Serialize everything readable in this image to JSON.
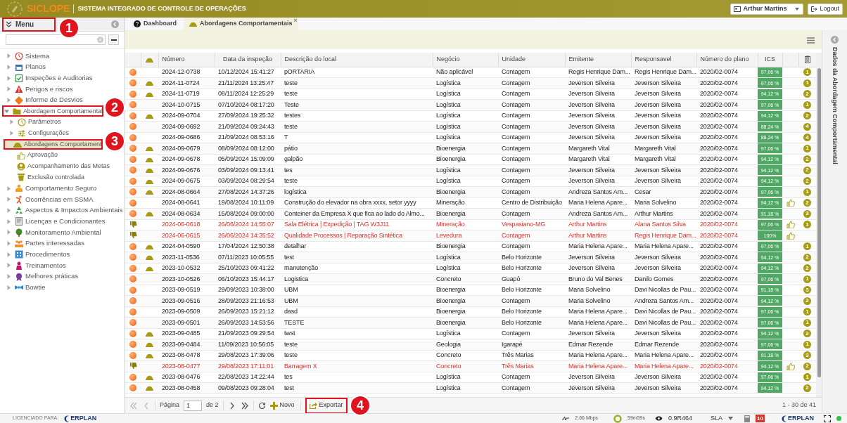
{
  "header": {
    "logo": "SICLOPE",
    "subtitle": "SISTEMA INTEGRADO DE CONTROLE DE OPERAÇÕES",
    "user": "Arthur Martins",
    "logout": "Logout"
  },
  "menu": {
    "title": "Menu",
    "items": [
      {
        "label": "Sistema",
        "kind": "branch",
        "expanded": false,
        "selected": false
      },
      {
        "label": "Planos",
        "kind": "branch",
        "expanded": false,
        "selected": false
      },
      {
        "label": "Inspeções e Auditorias",
        "kind": "branch",
        "expanded": false,
        "selected": false
      },
      {
        "label": "Perigos e riscos",
        "kind": "branch",
        "expanded": false,
        "selected": false
      },
      {
        "label": "Informe de Desvios",
        "kind": "branch",
        "expanded": false,
        "selected": false
      },
      {
        "label": "Abordagem Comportamental",
        "kind": "branch",
        "expanded": true,
        "selected": false,
        "children": [
          {
            "label": "Parâmetros",
            "kind": "branch",
            "expanded": false,
            "selected": false
          },
          {
            "label": "Configurações",
            "kind": "branch",
            "expanded": false,
            "selected": false
          },
          {
            "label": "Abordagens Comportament",
            "kind": "leaf",
            "selected": true
          },
          {
            "label": "Aprovação",
            "kind": "leaf",
            "selected": false
          },
          {
            "label": "Acompanhamento das Metas",
            "kind": "leaf",
            "selected": false
          },
          {
            "label": "Exclusão controlada",
            "kind": "leaf",
            "selected": false
          }
        ]
      },
      {
        "label": "Comportamento Seguro",
        "kind": "branch",
        "expanded": false,
        "selected": false
      },
      {
        "label": "Ocorrências em SSMA",
        "kind": "branch",
        "expanded": false,
        "selected": false
      },
      {
        "label": "Aspectos & Impactos Ambientais",
        "kind": "branch",
        "expanded": false,
        "selected": false
      },
      {
        "label": "Licenças e Condicionantes",
        "kind": "branch",
        "expanded": false,
        "selected": false
      },
      {
        "label": "Monitoramento Ambiental",
        "kind": "branch",
        "expanded": false,
        "selected": false
      },
      {
        "label": "Partes interessadas",
        "kind": "branch",
        "expanded": false,
        "selected": false
      },
      {
        "label": "Procedimentos",
        "kind": "branch",
        "expanded": false,
        "selected": false
      },
      {
        "label": "Treinamentos",
        "kind": "branch",
        "expanded": false,
        "selected": false
      },
      {
        "label": "Melhores práticas",
        "kind": "branch",
        "expanded": false,
        "selected": false
      },
      {
        "label": "Bowtie",
        "kind": "branch",
        "expanded": false,
        "selected": false
      }
    ]
  },
  "tabs": [
    {
      "label": "Dashboard",
      "selected": false
    },
    {
      "label": "Abordagens Comportamentais",
      "selected": true,
      "close": "×"
    }
  ],
  "side_panel": {
    "title": "Dados da Abordagem Comportamental"
  },
  "table": {
    "columns": [
      "Número",
      "Data da inspeção",
      "Descrição do local",
      "Negócio",
      "Unidade",
      "Emitente",
      "Responsavel",
      "Número do plano",
      "ICS"
    ],
    "rows": [
      {
        "kind": "dot",
        "helmet": false,
        "number": "2024-12-0738",
        "date": "10/12/2024 15:41:27",
        "location": "pORTARIA",
        "business": "Não aplicável",
        "unit": "Contagem",
        "issuer": "Regis Henrique Dam...",
        "responsible": "Regis Henrique Dam...",
        "plan": "2020/02-0074",
        "ics": "97,06 %",
        "approved": false,
        "count": "1",
        "flagged": false
      },
      {
        "kind": "dot",
        "helmet": true,
        "number": "2024-11-0724",
        "date": "21/11/2024 13:25:47",
        "location": "teste",
        "business": "Logística",
        "unit": "Contagem",
        "issuer": "Jeverson Silveira",
        "responsible": "Jeverson Silveira",
        "plan": "2020/02-0074",
        "ics": "97,06 %",
        "approved": false,
        "count": "1",
        "flagged": false
      },
      {
        "kind": "dot",
        "helmet": true,
        "number": "2024-11-0719",
        "date": "08/11/2024 12:25:29",
        "location": "teste",
        "business": "Logística",
        "unit": "Contagem",
        "issuer": "Jeverson Silveira",
        "responsible": "Jeverson Silveira",
        "plan": "2020/02-0074",
        "ics": "94,12 %",
        "approved": false,
        "count": "2",
        "flagged": false
      },
      {
        "kind": "dot",
        "helmet": false,
        "number": "2024-10-0715",
        "date": "07/10/2024 08:17:20",
        "location": "Teste",
        "business": "Logística",
        "unit": "Contagem",
        "issuer": "Jeverson Silveira",
        "responsible": "Jeverson Silveira",
        "plan": "2020/02-0074",
        "ics": "97,06 %",
        "approved": false,
        "count": "1",
        "flagged": false
      },
      {
        "kind": "dot",
        "helmet": true,
        "number": "2024-09-0704",
        "date": "27/09/2024 19:25:32",
        "location": "testes",
        "business": "Logística",
        "unit": "Contagem",
        "issuer": "Jeverson Silveira",
        "responsible": "Jeverson Silveira",
        "plan": "2020/02-0074",
        "ics": "94,12 %",
        "approved": false,
        "count": "2",
        "flagged": false
      },
      {
        "kind": "dot",
        "helmet": false,
        "number": "2024-09-0692",
        "date": "21/09/2024 09:24:43",
        "location": "teste",
        "business": "Logística",
        "unit": "Contagem",
        "issuer": "Jeverson Silveira",
        "responsible": "Jeverson Silveira",
        "plan": "2020/02-0074",
        "ics": "88,24 %",
        "approved": false,
        "count": "4",
        "flagged": false
      },
      {
        "kind": "dot",
        "helmet": false,
        "number": "2024-09-0686",
        "date": "21/09/2024 08:53:16",
        "location": "T",
        "business": "Logística",
        "unit": "Contagem",
        "issuer": "Jeverson Silveira",
        "responsible": "Jeverson Silveira",
        "plan": "2020/02-0074",
        "ics": "88,24 %",
        "approved": false,
        "count": "4",
        "flagged": false
      },
      {
        "kind": "dot",
        "helmet": true,
        "number": "2024-09-0679",
        "date": "08/09/2024 08:12:00",
        "location": "pátio",
        "business": "Bioenergia",
        "unit": "Contagem",
        "issuer": "Margareth Vital",
        "responsible": "Margareth Vital",
        "plan": "2020/02-0074",
        "ics": "97,06 %",
        "approved": false,
        "count": "1",
        "flagged": false
      },
      {
        "kind": "dot",
        "helmet": true,
        "number": "2024-09-0678",
        "date": "05/09/2024 15:09:09",
        "location": "galpão",
        "business": "Bioenergia",
        "unit": "Contagem",
        "issuer": "Margareth Vital",
        "responsible": "Margareth Vital",
        "plan": "2020/02-0074",
        "ics": "94,12 %",
        "approved": false,
        "count": "2",
        "flagged": false
      },
      {
        "kind": "dot",
        "helmet": true,
        "number": "2024-09-0676",
        "date": "03/09/2024 09:13:41",
        "location": "tes",
        "business": "Logística",
        "unit": "Contagem",
        "issuer": "Jeverson Silveira",
        "responsible": "Jeverson Silveira",
        "plan": "2020/02-0074",
        "ics": "94,12 %",
        "approved": false,
        "count": "2",
        "flagged": false
      },
      {
        "kind": "dot",
        "helmet": true,
        "number": "2024-09-0675",
        "date": "03/09/2024 08:29:54",
        "location": "teste",
        "business": "Logística",
        "unit": "Contagem",
        "issuer": "Jeverson Silveira",
        "responsible": "Jeverson Silveira",
        "plan": "2020/02-0074",
        "ics": "94,12 %",
        "approved": false,
        "count": "2",
        "flagged": false
      },
      {
        "kind": "dot",
        "helmet": true,
        "number": "2024-08-0664",
        "date": "27/08/2024 14:37:26",
        "location": "logística",
        "business": "Bioenergia",
        "unit": "Contagem",
        "issuer": "Andreza Santos Am...",
        "responsible": "Cesar",
        "plan": "2020/02-0074",
        "ics": "97,06 %",
        "approved": false,
        "count": "1",
        "flagged": false
      },
      {
        "kind": "dot",
        "helmet": false,
        "number": "2024-08-0641",
        "date": "19/08/2024 10:11:09",
        "location": "Construção do elevador na obra xxxx, setor yyyy",
        "business": "Mineração",
        "unit": "Centro de Distribuição",
        "issuer": "Maria Helena Apare...",
        "responsible": "Maria Solvelino",
        "plan": "2020/02-0074",
        "ics": "94,12 %",
        "approved": true,
        "count": "2",
        "flagged": false
      },
      {
        "kind": "dot",
        "helmet": true,
        "number": "2024-08-0634",
        "date": "15/08/2024 09:00:00",
        "location": "Conteiner da Empresa X que fica ao lado do Almo...",
        "business": "Bioenergia",
        "unit": "Contagem",
        "issuer": "Andreza Santos Am...",
        "responsible": "Arthur Martins",
        "plan": "2020/02-0074",
        "ics": "91,18 %",
        "approved": false,
        "count": "3",
        "flagged": false
      },
      {
        "kind": "thumb-down",
        "helmet": false,
        "number": "2024-06-0618",
        "date": "26/06/2024 14:55:07",
        "location": "Sala Elétrica | Expedição | TAG W3J11",
        "business": "Mineração",
        "unit": "Vespasiano-MG",
        "issuer": "Arthur Martins",
        "responsible": "Alana Santos Silva",
        "plan": "2020/02-0074",
        "ics": "97,06 %",
        "approved": true,
        "count": "1",
        "flagged": true
      },
      {
        "kind": "thumb-down",
        "helmet": false,
        "number": "2024-06-0615",
        "date": "26/06/2024 14:35:52",
        "location": "Qualidade Processos | Reparação Sintética",
        "business": "Levedura",
        "unit": "Contagem",
        "issuer": "Arthur Martins",
        "responsible": "Regis Henrique Dam...",
        "plan": "2020/02-0074",
        "ics": "100%",
        "approved": true,
        "flagged": true
      },
      {
        "kind": "dot",
        "helmet": true,
        "number": "2024-04-0590",
        "date": "17/04/2024 12:50:38",
        "location": "detalhar",
        "business": "Bioenergia",
        "unit": "Contagem",
        "issuer": "Maria Helena Apare...",
        "responsible": "Maria Helena Apare...",
        "plan": "2020/02-0074",
        "ics": "97,06 %",
        "approved": false,
        "count": "1",
        "flagged": false
      },
      {
        "kind": "dot",
        "helmet": true,
        "number": "2023-11-0536",
        "date": "07/11/2023 10:05:55",
        "location": "test",
        "business": "Logística",
        "unit": "Belo Horizonte",
        "issuer": "Jeverson Silveira",
        "responsible": "Jeverson Silveira",
        "plan": "2020/02-0074",
        "ics": "94,12 %",
        "approved": false,
        "count": "2",
        "flagged": false
      },
      {
        "kind": "dot",
        "helmet": true,
        "number": "2023-10-0532",
        "date": "25/10/2023 09:41:22",
        "location": "manutenção",
        "business": "Logística",
        "unit": "Belo Horizonte",
        "issuer": "Jeverson Silveira",
        "responsible": "Jeverson Silveira",
        "plan": "2020/02-0074",
        "ics": "94,12 %",
        "approved": false,
        "count": "2",
        "flagged": false
      },
      {
        "kind": "dot",
        "helmet": false,
        "number": "2023-10-0526",
        "date": "06/10/2023 15:44:17",
        "location": "Logistica",
        "business": "Concreto",
        "unit": "Guapó",
        "issuer": "Bruno do Val Benes",
        "responsible": "Danilo Gomes",
        "plan": "2020/02-0074",
        "ics": "97,06 %",
        "approved": false,
        "count": "1",
        "flagged": false
      },
      {
        "kind": "dot",
        "helmet": false,
        "number": "2023-09-0519",
        "date": "29/09/2023 10:38:00",
        "location": "UBM",
        "business": "Bioenergia",
        "unit": "Belo Horizonte",
        "issuer": "Maria Solvelino",
        "responsible": "Davi Nicollas de Pau...",
        "plan": "2020/02-0074",
        "ics": "91,18 %",
        "approved": false,
        "count": "3",
        "flagged": false
      },
      {
        "kind": "dot",
        "helmet": false,
        "number": "2023-09-0516",
        "date": "28/09/2023 21:16:53",
        "location": "UBM",
        "business": "Bioenergia",
        "unit": "Contagem",
        "issuer": "Maria Solvelino",
        "responsible": "Andreza Santos Am...",
        "plan": "2020/02-0074",
        "ics": "94,12 %",
        "approved": false,
        "count": "2",
        "flagged": false
      },
      {
        "kind": "dot",
        "helmet": false,
        "number": "2023-09-0509",
        "date": "26/09/2023 15:21:12",
        "location": "dasd",
        "business": "Bioenergia",
        "unit": "Belo Horizonte",
        "issuer": "Maria Helena Apare...",
        "responsible": "Davi Nicollas de Pau...",
        "plan": "2020/02-0074",
        "ics": "97,06 %",
        "approved": false,
        "count": "1",
        "flagged": false
      },
      {
        "kind": "dot",
        "helmet": false,
        "number": "2023-09-0501",
        "date": "26/09/2023 14:53:56",
        "location": "TESTE",
        "business": "Bioenergia",
        "unit": "Belo Horizonte",
        "issuer": "Maria Helena Apare...",
        "responsible": "Davi Nicollas de Pau...",
        "plan": "2020/02-0074",
        "ics": "97,06 %",
        "approved": false,
        "count": "1",
        "flagged": false
      },
      {
        "kind": "dot",
        "helmet": true,
        "number": "2023-09-0485",
        "date": "21/09/2023 09:29:54",
        "location": "twst",
        "business": "Logística",
        "unit": "Contagem",
        "issuer": "Jeverson Silveira",
        "responsible": "Jeverson Silveira",
        "plan": "2020/02-0074",
        "ics": "94,12 %",
        "approved": false,
        "count": "2",
        "flagged": false
      },
      {
        "kind": "dot",
        "helmet": true,
        "number": "2023-09-0484",
        "date": "11/09/2023 10:56:05",
        "location": "teste",
        "business": "Geologia",
        "unit": "Igarapé",
        "issuer": "Edmar Rezende",
        "responsible": "Edmar Rezende",
        "plan": "2020/02-0074",
        "ics": "97,06 %",
        "approved": false,
        "count": "1",
        "flagged": false
      },
      {
        "kind": "dot",
        "helmet": true,
        "number": "2023-08-0478",
        "date": "29/08/2023 17:39:06",
        "location": "teste",
        "business": "Concreto",
        "unit": "Três Marias",
        "issuer": "Maria Helena Apare...",
        "responsible": "Maria Helena Apare...",
        "plan": "2020/02-0074",
        "ics": "91,18 %",
        "approved": false,
        "count": "3",
        "flagged": false
      },
      {
        "kind": "thumb-down",
        "helmet": false,
        "number": "2023-08-0477",
        "date": "29/08/2023 17:11:01",
        "location": "Barragem X",
        "business": "Concreto",
        "unit": "Três Marias",
        "issuer": "Maria Helena Apare...",
        "responsible": "Maria Helena Apare...",
        "plan": "2020/02-0074",
        "ics": "94,12 %",
        "approved": true,
        "count": "2",
        "flagged": true
      },
      {
        "kind": "dot",
        "helmet": true,
        "number": "2023-08-0476",
        "date": "22/08/2023 14:22:44",
        "location": "tes",
        "business": "Logística",
        "unit": "Contagem",
        "issuer": "Jeverson Silveira",
        "responsible": "Jeverson Silveira",
        "plan": "2020/02-0074",
        "ics": "97,06 %",
        "approved": false,
        "count": "1",
        "flagged": false
      },
      {
        "kind": "dot",
        "helmet": true,
        "number": "2023-08-0458",
        "date": "09/08/2023 09:28:04",
        "location": "test",
        "business": "Logística",
        "unit": "Contagem",
        "issuer": "Jeverson Silveira",
        "responsible": "Jeverson Silveira",
        "plan": "2020/02-0074",
        "ics": "94,12 %",
        "approved": false,
        "count": "2",
        "flagged": false
      }
    ]
  },
  "pager": {
    "page_label": "Página",
    "page": "1",
    "of": "de 2",
    "new": "Novo",
    "export": "Exportar",
    "range": "1 - 30 de 41"
  },
  "status_bar": {
    "license_label": "LICENCIADO PARA:",
    "logo": "ERPLAN",
    "speed": "2.66 Mbps",
    "timer": "59m59s",
    "version": "0.9R464",
    "sla": "SLA",
    "badge": "10",
    "logo_right": "ERPLAN"
  },
  "annotations": [
    {
      "label": "1"
    },
    {
      "label": "2"
    },
    {
      "label": "3"
    },
    {
      "label": "4"
    }
  ]
}
